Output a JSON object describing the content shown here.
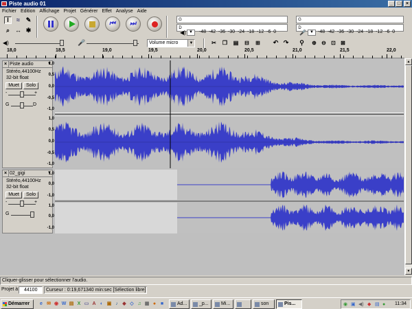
{
  "window": {
    "title": "Piste audio 01"
  },
  "menu": [
    "Fichier",
    "Edition",
    "Affichage",
    "Projet",
    "Générer",
    "Effet",
    "Analyse",
    "Aide"
  ],
  "meters": {
    "scale": [
      "-48",
      "-42",
      "-36",
      "-30",
      "-24",
      "-18",
      "-12",
      "-6",
      "0"
    ],
    "left_channel": "G",
    "right_channel": "D"
  },
  "mixer": {
    "input_source": "Volume micro"
  },
  "ruler": {
    "ticks": [
      "18,0",
      "18,5",
      "19,0",
      "19,5",
      "20,0",
      "20,5",
      "21,0",
      "21,5",
      "22,0"
    ]
  },
  "tracks": [
    {
      "name": "Piste audio",
      "format": "Stéréo,44100Hz",
      "sample": "32-bit float",
      "mute": "Muet",
      "solo": "Solo",
      "gain": "G",
      "pan": "D",
      "scale": [
        "1,0",
        "0,5",
        "0,0",
        "-0,5",
        "-1,0"
      ]
    },
    {
      "name": "02_gigi",
      "format": "Stéréo,44100Hz",
      "sample": "32-bit float",
      "mute": "Muet",
      "solo": "Solo",
      "gain": "G",
      "pan": "",
      "scale": [
        "1,0",
        "0,0",
        "-1,0"
      ]
    }
  ],
  "status": {
    "message": "Cliquer-glisser pour sélectionner l'audio."
  },
  "bottom": {
    "rate_label": "Projet à",
    "rate_value": "44100",
    "cursor_text": "Curseur : 0:19,671340 min:sec   [Sélection libre]"
  },
  "taskbar": {
    "start": "Démarrer",
    "tasks": [
      "Ad...",
      "_p...",
      "Mi...",
      "",
      "son",
      "Pis..."
    ],
    "clock": "11:34"
  }
}
